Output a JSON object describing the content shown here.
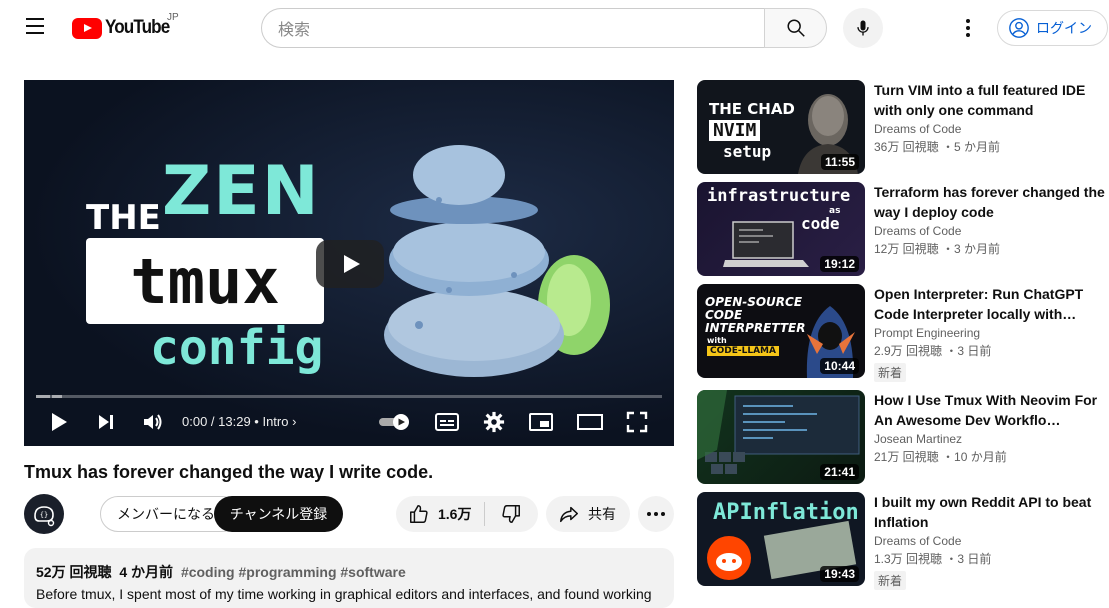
{
  "header": {
    "logo_text": "YouTube",
    "region": "JP",
    "search_placeholder": "検索",
    "login_label": "ログイン"
  },
  "player": {
    "thumb": {
      "the": "THE",
      "zen": "ZEN",
      "tmux": "tmux",
      "config": "config"
    },
    "time": "0:00 / 13:29",
    "chapter": "Intro",
    "progress": 0.0
  },
  "video": {
    "title": "Tmux has forever changed the way I write code.",
    "member_label": "メンバーになる",
    "subscribe_label": "チャンネル登録",
    "likes": "1.6万",
    "share_label": "共有",
    "views": "52万 回視聴",
    "age": "4 か月前",
    "tags": "#coding #programming #software",
    "description": "Before tmux, I spent most of my time working in graphical editors and interfaces, and found working"
  },
  "recommendations": [
    {
      "title": "Turn VIM into a full featured IDE with only one command",
      "channel": "Dreams of Code",
      "meta": "36万 回視聴 ・5 か月前",
      "duration": "11:55",
      "thumb_text_1": "THE CHAD",
      "thumb_text_2": "NVIM",
      "thumb_text_3": "setup",
      "badge": ""
    },
    {
      "title": "Terraform has forever changed the way I deploy code",
      "channel": "Dreams of Code",
      "meta": "12万 回視聴 ・3 か月前",
      "duration": "19:12",
      "thumb_text_1": "infrastructure",
      "thumb_text_2": "as",
      "thumb_text_3": "code",
      "badge": ""
    },
    {
      "title": "Open Interpreter: Run ChatGPT Code Interpreter locally with…",
      "channel": "Prompt Engineering",
      "meta": "2.9万 回視聴 ・3 日前",
      "duration": "10:44",
      "thumb_text_1": "OPEN-SOURCE CODE INTERPRETTER",
      "thumb_text_2": "with",
      "thumb_text_3": "CODE-LLAMA",
      "badge": "新着"
    },
    {
      "title": "How I Use Tmux With Neovim For An Awesome Dev Workflo…",
      "channel": "Josean Martinez",
      "meta": "21万 回視聴 ・10 か月前",
      "duration": "21:41",
      "thumb_text_1": "",
      "thumb_text_2": "",
      "thumb_text_3": "",
      "badge": ""
    },
    {
      "title": "I built my own Reddit API to beat Inflation",
      "channel": "Dreams of Code",
      "meta": "1.3万 回視聴 ・3 日前",
      "duration": "19:43",
      "thumb_text_1": "APInflation",
      "thumb_text_2": "",
      "thumb_text_3": "",
      "badge": "新着"
    }
  ],
  "colors": {
    "brand_red": "#ff0000",
    "link_blue": "#065fd4",
    "accent_teal": "#7ee8d8"
  }
}
